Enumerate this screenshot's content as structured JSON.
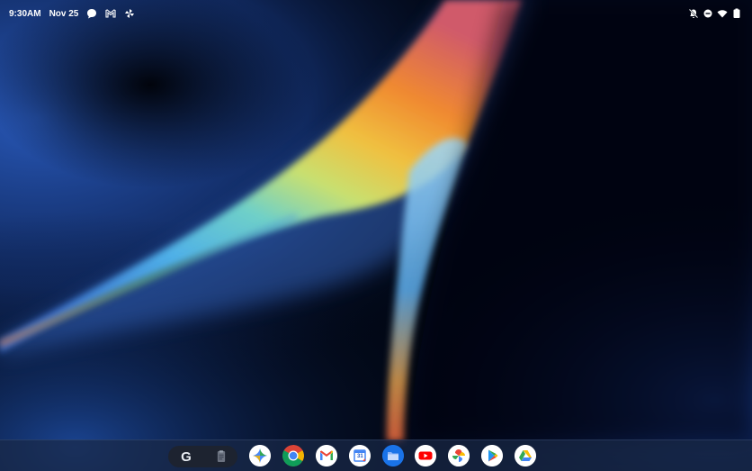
{
  "status_bar": {
    "time": "9:30AM",
    "date": "Nov 25",
    "left_icons": [
      "chat-icon",
      "gmail-icon",
      "pinwheel-icon"
    ],
    "right_icons": [
      "notifications-off-icon",
      "do-not-disturb-icon",
      "wifi-icon",
      "battery-icon"
    ]
  },
  "taskbar": {
    "search_pill": {
      "google_letter": "G",
      "icons": [
        "google-search-icon",
        "clipboard-icon"
      ]
    },
    "apps": [
      {
        "name": "gemini",
        "icon": "gemini-icon"
      },
      {
        "name": "chrome",
        "icon": "chrome-icon"
      },
      {
        "name": "gmail",
        "icon": "gmail-icon"
      },
      {
        "name": "calendar",
        "icon": "calendar-icon",
        "label": "31"
      },
      {
        "name": "files",
        "icon": "files-icon"
      },
      {
        "name": "youtube",
        "icon": "youtube-icon"
      },
      {
        "name": "photos",
        "icon": "photos-icon"
      },
      {
        "name": "play-store",
        "icon": "play-store-icon"
      },
      {
        "name": "drive",
        "icon": "drive-icon"
      }
    ]
  },
  "colors": {
    "wallpaper_base": "#020816",
    "wallpaper_blue": "#1f4fa8",
    "taskbar": "#192846",
    "search_pill": "#1d2330"
  }
}
